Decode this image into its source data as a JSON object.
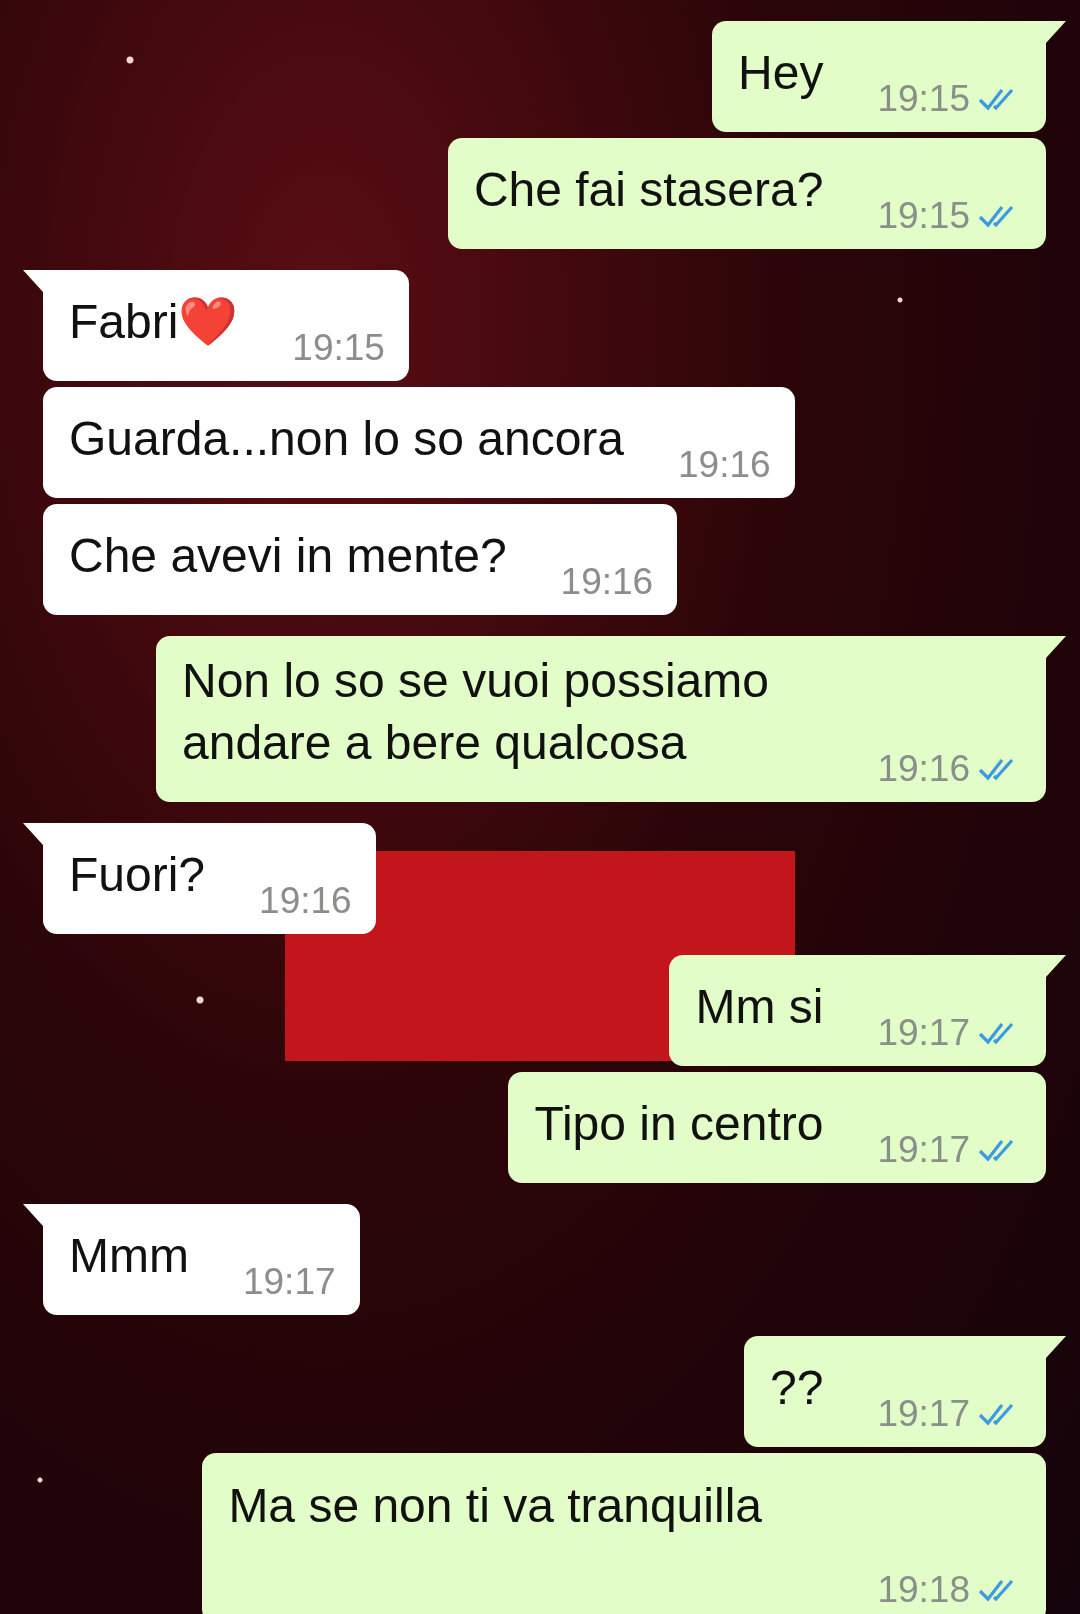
{
  "messages": [
    {
      "kind": "sent",
      "text": "Hey",
      "time": "19:15",
      "read": true,
      "tail": true,
      "time_below": false
    },
    {
      "kind": "sent",
      "text": "Che fai stasera?",
      "time": "19:15",
      "read": true,
      "tail": false,
      "time_below": false
    },
    {
      "kind": "received",
      "text": "Fabri❤️",
      "time": "19:15",
      "tail": true,
      "time_below": false
    },
    {
      "kind": "received",
      "text": "Guarda...non lo so ancora",
      "time": "19:16",
      "tail": false,
      "time_below": false
    },
    {
      "kind": "received",
      "text": "Che avevi in mente?",
      "time": "19:16",
      "tail": false,
      "time_below": false
    },
    {
      "kind": "sent",
      "text": "Non lo so se vuoi possiamo andare a bere qualcosa",
      "time": "19:16",
      "read": true,
      "tail": true,
      "time_below": false
    },
    {
      "kind": "received",
      "text": "Fuori?",
      "time": "19:16",
      "tail": true,
      "time_below": false
    },
    {
      "kind": "sent",
      "text": "Mm si",
      "time": "19:17",
      "read": true,
      "tail": true,
      "time_below": false
    },
    {
      "kind": "sent",
      "text": "Tipo in centro",
      "time": "19:17",
      "read": true,
      "tail": false,
      "time_below": false
    },
    {
      "kind": "received",
      "text": "Mmm",
      "time": "19:17",
      "tail": true,
      "time_below": false
    },
    {
      "kind": "sent",
      "text": "??",
      "time": "19:17",
      "read": true,
      "tail": true,
      "time_below": false
    },
    {
      "kind": "sent",
      "text": "Ma se non ti va tranquilla",
      "time": "19:18",
      "read": true,
      "tail": false,
      "time_below": true
    }
  ]
}
